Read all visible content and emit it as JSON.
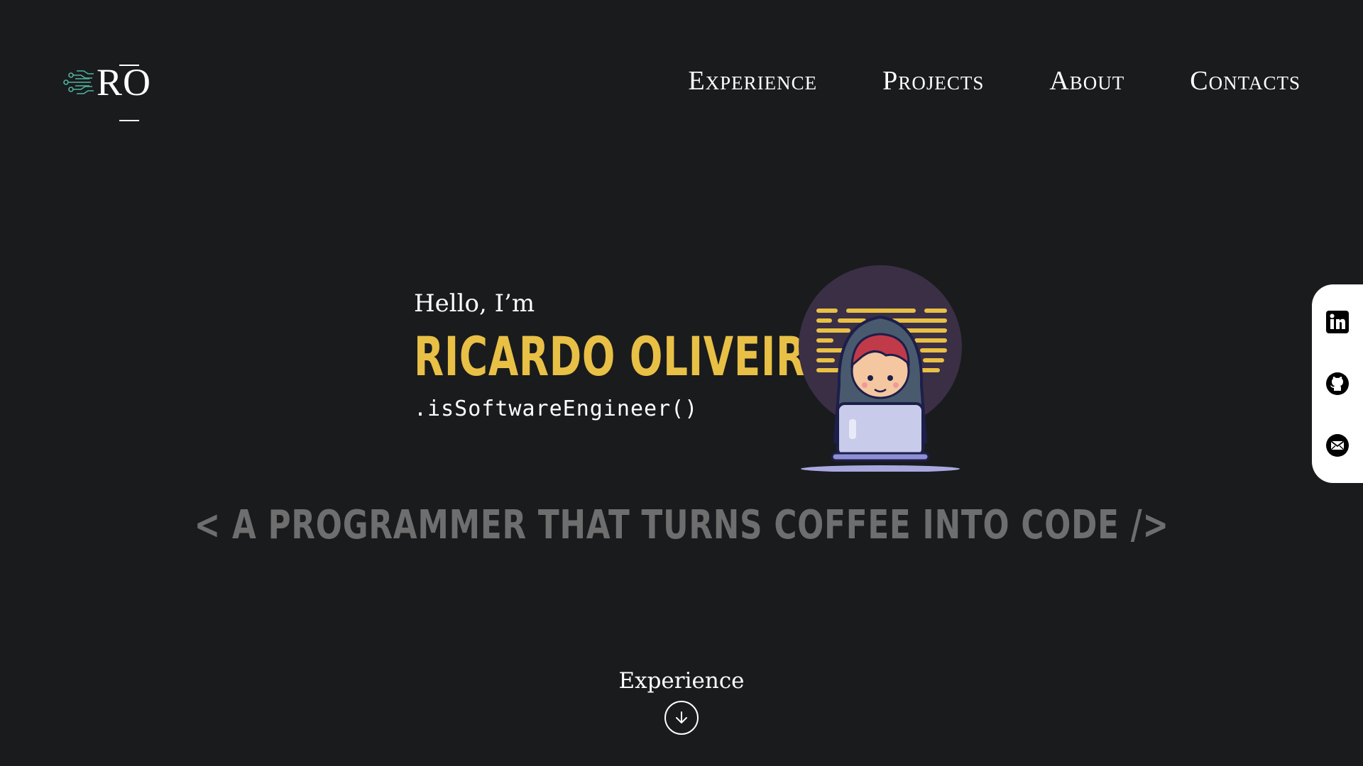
{
  "header": {
    "logo_text": "RO",
    "nav": [
      {
        "label": "Experience"
      },
      {
        "label": "Projects"
      },
      {
        "label": "About"
      },
      {
        "label": "Contacts"
      }
    ]
  },
  "hero": {
    "greeting": "Hello, I’m",
    "name": "RICARDO OLIVEIRA",
    "role": ".isSoftwareEngineer()",
    "tagline": "< A PROGRAMMER THAT TURNS COFFEE INTO CODE />"
  },
  "scroll_hint": {
    "label": "Experience"
  },
  "social": [
    "linkedin-icon",
    "github-icon",
    "email-icon"
  ],
  "colors": {
    "background": "#1a1b1d",
    "accent": "#e9c046",
    "tagline": "#6e6e6e",
    "logo_circuit": "#4fb3a0",
    "sidebar": "#ffffff"
  }
}
